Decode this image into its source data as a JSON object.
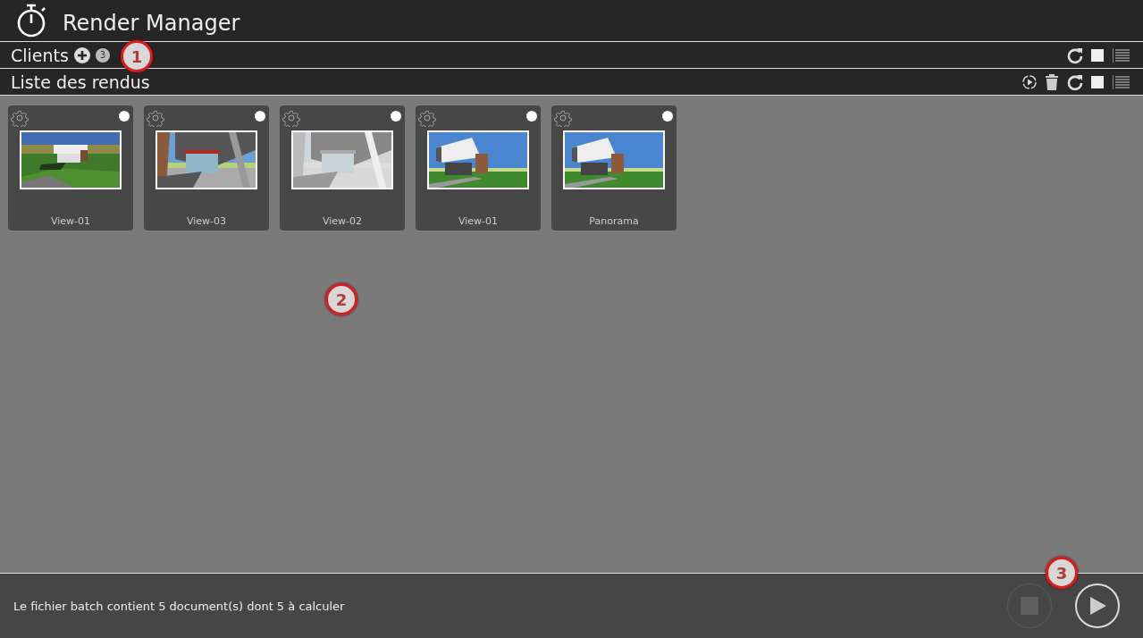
{
  "window": {
    "title": "Render Manager"
  },
  "clients_bar": {
    "label": "Clients",
    "count": "3",
    "grid_view": true
  },
  "renders_bar": {
    "label": "Liste des rendus",
    "grid_view": true
  },
  "renders": [
    {
      "name": "View-01",
      "selected": false
    },
    {
      "name": "View-03",
      "selected": false
    },
    {
      "name": "View-02",
      "selected": false
    },
    {
      "name": "View-01",
      "selected": false
    },
    {
      "name": "Panorama",
      "selected": false
    }
  ],
  "status_bar": {
    "message": "Le fichier batch contient 5 document(s) dont 5 à calculer",
    "stop_disabled": true,
    "play_disabled": false
  },
  "callouts": [
    "1",
    "2",
    "3"
  ]
}
